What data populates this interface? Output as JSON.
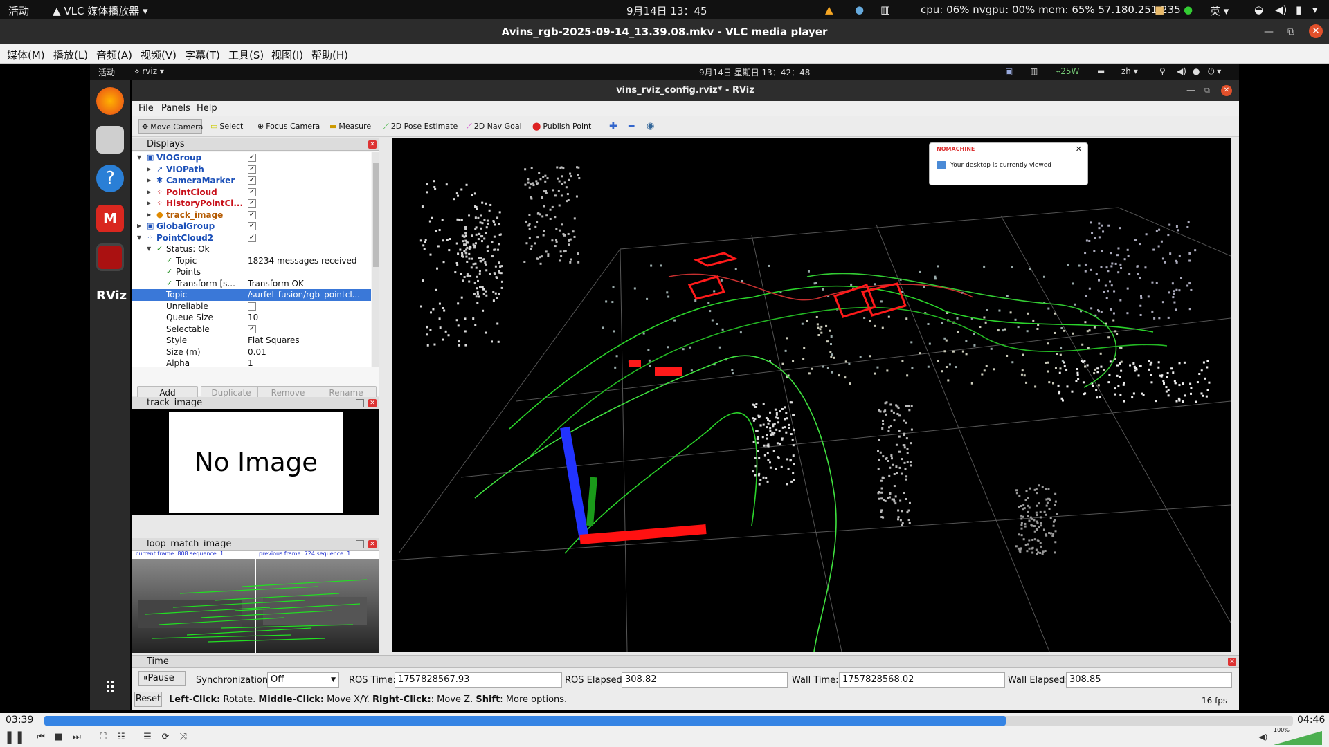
{
  "topbar": {
    "activities": "活动",
    "app_name": "VLC 媒体播放器",
    "clock": "9月14日  13：45",
    "stats": "cpu: 06% nvgpu: 00% mem: 65% 57.180.251.235",
    "lang": "英"
  },
  "vlc": {
    "title": "Avins_rgb-2025-09-14_13.39.08.mkv - VLC media player",
    "menu": [
      "媒体(M)",
      "播放(L)",
      "音频(A)",
      "视频(V)",
      "字幕(T)",
      "工具(S)",
      "视图(I)",
      "帮助(H)"
    ],
    "elapsed": "03:39",
    "total": "04:46",
    "progress": 0.77,
    "volume": "100%"
  },
  "remote": {
    "activities": "活动",
    "app": "rviz",
    "clock": "9月14日 星期日 13：42：48",
    "power": "25W",
    "lang": "zh"
  },
  "rviz": {
    "title": "vins_rviz_config.rviz* - RViz",
    "menu": [
      "File",
      "Panels",
      "Help"
    ],
    "tools": [
      "Move Camera",
      "Select",
      "Focus Camera",
      "Measure",
      "2D Pose Estimate",
      "2D Nav Goal",
      "Publish Point"
    ],
    "displays_title": "Displays",
    "tree": [
      {
        "name": "VIOGroup",
        "cls": "blue",
        "depth": 0,
        "arrow": "▼",
        "icon": "▣",
        "checked": true
      },
      {
        "name": "VIOPath",
        "cls": "blue",
        "depth": 1,
        "arrow": "▶",
        "icon": "↗",
        "checked": true
      },
      {
        "name": "CameraMarker",
        "cls": "blue",
        "depth": 1,
        "arrow": "▶",
        "icon": "✱",
        "checked": true
      },
      {
        "name": "PointCloud",
        "cls": "red",
        "depth": 1,
        "arrow": "▶",
        "icon": "⁘",
        "checked": true
      },
      {
        "name": "HistoryPointCl...",
        "cls": "red",
        "depth": 1,
        "arrow": "▶",
        "icon": "⁘",
        "checked": true
      },
      {
        "name": "track_image",
        "cls": "orange",
        "depth": 1,
        "arrow": "▶",
        "icon": "●",
        "checked": true
      },
      {
        "name": "GlobalGroup",
        "cls": "blue",
        "depth": 0,
        "arrow": "▶",
        "icon": "▣",
        "checked": true
      },
      {
        "name": "PointCloud2",
        "cls": "blue",
        "depth": 0,
        "arrow": "▼",
        "icon": "⁘",
        "checked": true
      },
      {
        "name": "Status: Ok",
        "cls": "",
        "depth": 1,
        "arrow": "▼",
        "icon": "✓",
        "value": ""
      },
      {
        "name": "Topic",
        "cls": "",
        "depth": 2,
        "arrow": "",
        "icon": "✓",
        "value": "18234 messages received"
      },
      {
        "name": "Points",
        "cls": "",
        "depth": 2,
        "arrow": "",
        "icon": "✓",
        "value": ""
      },
      {
        "name": "Transform [s...",
        "cls": "",
        "depth": 2,
        "arrow": "",
        "icon": "✓",
        "value": "Transform OK"
      },
      {
        "name": "Topic",
        "cls": "",
        "depth": 1,
        "arrow": "",
        "icon": "",
        "value": "/surfel_fusion/rgb_pointcl...",
        "selected": true
      },
      {
        "name": "Unreliable",
        "cls": "",
        "depth": 1,
        "arrow": "",
        "icon": "",
        "checked": false
      },
      {
        "name": "Queue Size",
        "cls": "",
        "depth": 1,
        "arrow": "",
        "icon": "",
        "value": "10"
      },
      {
        "name": "Selectable",
        "cls": "",
        "depth": 1,
        "arrow": "",
        "icon": "",
        "checked": true
      },
      {
        "name": "Style",
        "cls": "",
        "depth": 1,
        "arrow": "",
        "icon": "",
        "value": "Flat Squares"
      },
      {
        "name": "Size (m)",
        "cls": "",
        "depth": 1,
        "arrow": "",
        "icon": "",
        "value": "0.01"
      },
      {
        "name": "Alpha",
        "cls": "",
        "depth": 1,
        "arrow": "",
        "icon": "",
        "value": "1"
      }
    ],
    "buttons": [
      "Add",
      "Duplicate",
      "Remove",
      "Rename"
    ],
    "track_panel": "track_image",
    "no_image": "No Image",
    "loop_panel": "loop_match_image",
    "loop_caption_left": "current frame: 808   sequence: 1",
    "loop_caption_right": "previous frame: 724   sequence: 1",
    "notification": {
      "brand": "NOMACHINE",
      "text": "Your desktop is currently viewed"
    },
    "time": {
      "title": "Time",
      "pause": "Pause",
      "sync_label": "Synchronization:",
      "sync_value": "Off",
      "ros_time_label": "ROS Time:",
      "ros_time": "1757828567.93",
      "ros_elapsed_label": "ROS Elapsed:",
      "ros_elapsed": "308.82",
      "wall_time_label": "Wall Time:",
      "wall_time": "1757828568.02",
      "wall_elapsed_label": "Wall Elapsed:",
      "wall_elapsed": "308.85",
      "reset": "Reset",
      "fps": "16 fps"
    },
    "hint": [
      {
        "b": "Left-Click:",
        "t": " Rotate. "
      },
      {
        "b": "Middle-Click:",
        "t": " Move X/Y. "
      },
      {
        "b": "Right-Click:",
        "t": ": Move Z. "
      },
      {
        "b": "Shift",
        "t": ": More options."
      }
    ]
  }
}
